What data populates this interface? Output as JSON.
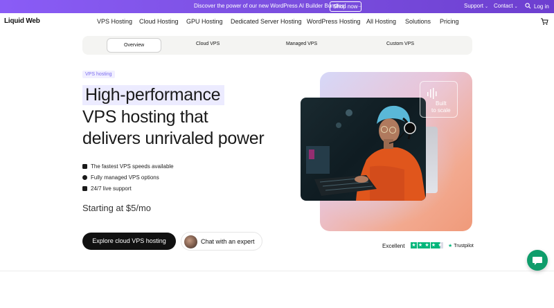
{
  "promo": {
    "message": "Discover the power of our new WordPress AI Builder Bundles!",
    "cta": "Shop now",
    "support": "Support",
    "contact": "Contact",
    "login": "Log in"
  },
  "nav": {
    "logo": "Liquid Web",
    "items": [
      "VPS Hosting",
      "Cloud Hosting",
      "GPU Hosting",
      "Dedicated Server Hosting",
      "WordPress Hosting",
      "All Hosting",
      "Solutions",
      "Pricing"
    ]
  },
  "subnav": {
    "tabs": [
      "Overview",
      "Cloud VPS",
      "Managed VPS",
      "Custom VPS"
    ],
    "active": "Overview"
  },
  "hero": {
    "eyebrow": "VPS hosting",
    "headline_1": "High-performance",
    "headline_2": "VPS hosting that",
    "headline_3": "delivers unrivaled power",
    "features": [
      "The fastest VPS speeds available",
      "Fully managed VPS options",
      "24/7 live support"
    ],
    "price": "Starting at $5/mo",
    "primary_cta": "Explore cloud VPS hosting",
    "secondary_cta": "Chat with an expert",
    "badge_line1": "Built",
    "badge_line2": "to scale"
  },
  "trust": {
    "label": "Excellent",
    "brand": "Trustpilot",
    "rating": 4.5
  },
  "colors": {
    "promo": "#7b4fe0",
    "trustpilot_green": "#00b67a",
    "chat_fab": "#0f9d6b"
  }
}
